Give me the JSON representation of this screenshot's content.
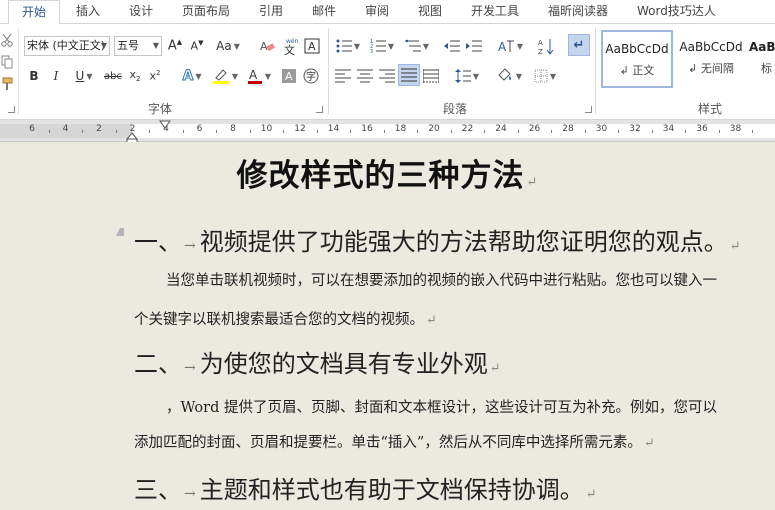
{
  "tabs": [
    {
      "label": "开始",
      "active": true
    },
    {
      "label": "插入"
    },
    {
      "label": "设计"
    },
    {
      "label": "页面布局"
    },
    {
      "label": "引用"
    },
    {
      "label": "邮件"
    },
    {
      "label": "审阅"
    },
    {
      "label": "视图"
    },
    {
      "label": "开发工具"
    },
    {
      "label": "福昕阅读器"
    },
    {
      "label": "Word技巧达人"
    }
  ],
  "font_group": {
    "label": "字体",
    "font_name": "宋体 (中文正文)",
    "font_size": "五号"
  },
  "paragraph_group": {
    "label": "段落"
  },
  "styles_group": {
    "label": "样式",
    "items": [
      {
        "sample": "AaBbCcDd",
        "name": "↲ 正文",
        "selected": true
      },
      {
        "sample": "AaBbCcDd",
        "name": "↲ 无间隔"
      },
      {
        "sample": "AaBl",
        "name": "标"
      }
    ]
  },
  "ruler": {
    "labels": [
      "6",
      "4",
      "2",
      "2",
      "4",
      "6",
      "8",
      "10",
      "12",
      "14",
      "16",
      "18",
      "20",
      "22",
      "24",
      "26",
      "28",
      "30",
      "32",
      "34",
      "36",
      "38"
    ]
  },
  "document": {
    "title": "修改样式的三种方法",
    "paragraph_mark": "↵",
    "sections": [
      {
        "number": "一、",
        "heading": "视频提供了功能强大的方法帮助您证明您的观点。",
        "body": [
          "当您单击联机视频时，可以在想要添加的视频的嵌入代码中进行粘贴。您也可以键入一",
          "个关键字以联机搜索最适合您的文档的视频。"
        ]
      },
      {
        "number": "二、",
        "heading": "为使您的文档具有专业外观",
        "body": [
          "，Word 提供了页眉、页脚、封面和文本框设计，这些设计可互为补充。例如，您可以",
          "添加匹配的封面、页眉和提要栏。单击“插入”，然后从不同库中选择所需元素。"
        ]
      },
      {
        "number": "三、",
        "heading": "主题和样式也有助于文档保持协调。",
        "body": []
      }
    ]
  },
  "colors": {
    "accent": "#2b579a",
    "page_background": "#eceadf",
    "font_color_bar": "#c00000",
    "highlight_bar": "#ffff00"
  }
}
